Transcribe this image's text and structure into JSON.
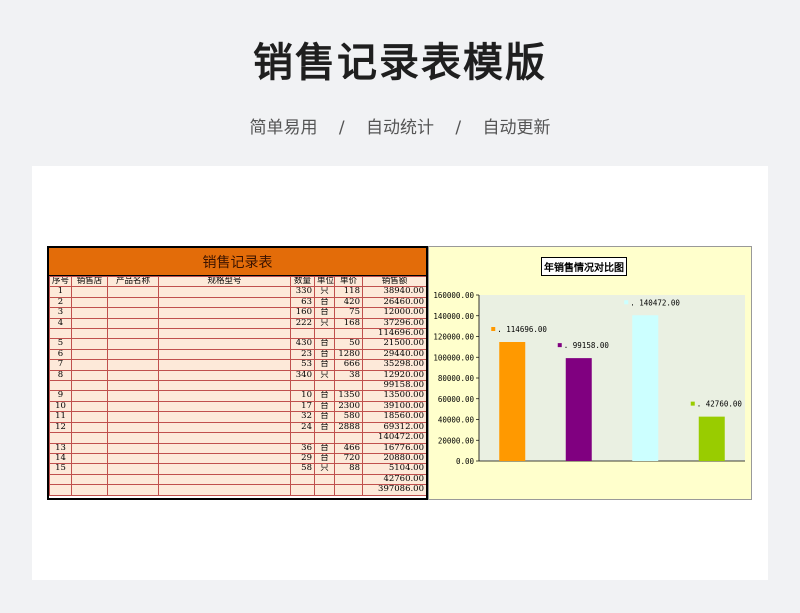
{
  "page": {
    "title": "销售记录表模版",
    "features": [
      "简单易用",
      "自动统计",
      "自动更新"
    ],
    "separator": "/"
  },
  "sheet": {
    "title": "销售记录表",
    "columns": [
      "序号",
      "销售店",
      "产品名称",
      "规格型号",
      "数量",
      "单位",
      "单价",
      "销售额"
    ],
    "rows": [
      [
        "1",
        "",
        "",
        "",
        "330",
        "只",
        "118",
        "38940.00"
      ],
      [
        "2",
        "",
        "",
        "",
        "63",
        "台",
        "420",
        "26460.00"
      ],
      [
        "3",
        "",
        "",
        "",
        "160",
        "台",
        "75",
        "12000.00"
      ],
      [
        "4",
        "",
        "",
        "",
        "222",
        "只",
        "168",
        "37296.00"
      ],
      [
        "",
        "",
        "",
        "",
        "",
        "",
        "",
        "114696.00"
      ],
      [
        "5",
        "",
        "",
        "",
        "430",
        "台",
        "50",
        "21500.00"
      ],
      [
        "6",
        "",
        "",
        "",
        "23",
        "台",
        "1280",
        "29440.00"
      ],
      [
        "7",
        "",
        "",
        "",
        "53",
        "台",
        "666",
        "35298.00"
      ],
      [
        "8",
        "",
        "",
        "",
        "340",
        "只",
        "38",
        "12920.00"
      ],
      [
        "",
        "",
        "",
        "",
        "",
        "",
        "",
        "99158.00"
      ],
      [
        "9",
        "",
        "",
        "",
        "10",
        "台",
        "1350",
        "13500.00"
      ],
      [
        "10",
        "",
        "",
        "",
        "17",
        "台",
        "2300",
        "39100.00"
      ],
      [
        "11",
        "",
        "",
        "",
        "32",
        "台",
        "580",
        "18560.00"
      ],
      [
        "12",
        "",
        "",
        "",
        "24",
        "台",
        "2888",
        "69312.00"
      ],
      [
        "",
        "",
        "",
        "",
        "",
        "",
        "",
        "140472.00"
      ],
      [
        "13",
        "",
        "",
        "",
        "36",
        "台",
        "466",
        "16776.00"
      ],
      [
        "14",
        "",
        "",
        "",
        "29",
        "台",
        "720",
        "20880.00"
      ],
      [
        "15",
        "",
        "",
        "",
        "58",
        "只",
        "88",
        "5104.00"
      ],
      [
        "",
        "",
        "",
        "",
        "",
        "",
        "",
        "42760.00"
      ],
      [
        "",
        "",
        "",
        "",
        "",
        "",
        "",
        "397086.00"
      ]
    ]
  },
  "chart_data": {
    "type": "bar",
    "title": "年销售情况对比图",
    "values": [
      114696.0,
      99158.0,
      140472.0,
      42760.0
    ],
    "value_labels": [
      ". 114696.00",
      ". 99158.00",
      ". 140472.00",
      ". 42760.00"
    ],
    "colors": [
      "#ff9900",
      "#800080",
      "#ccffff",
      "#99cc00"
    ],
    "ylim": [
      0,
      160000
    ],
    "yticks": [
      "0.00",
      "20000.00",
      "40000.00",
      "60000.00",
      "80000.00",
      "100000.00",
      "120000.00",
      "140000.00",
      "160000.00"
    ],
    "grid": false,
    "legend": "none"
  }
}
